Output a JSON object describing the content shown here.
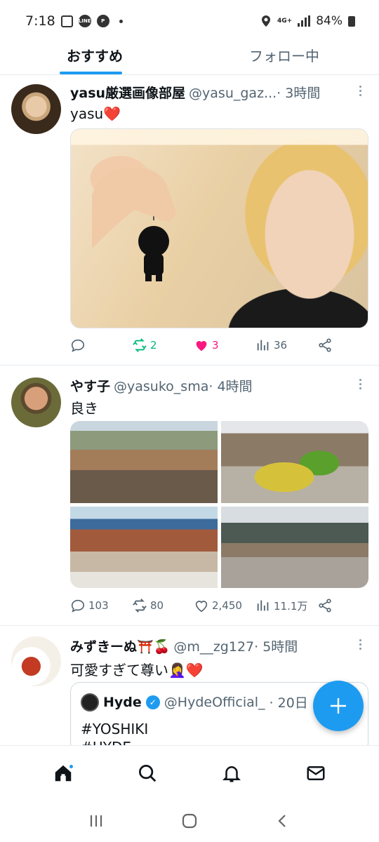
{
  "status_bar": {
    "time": "7:18",
    "line_label": "LINE",
    "network": "4G+",
    "battery": "84%"
  },
  "tabs": [
    {
      "label": "おすすめ",
      "active": true
    },
    {
      "label": "フォロー中",
      "active": false
    }
  ],
  "tweets": [
    {
      "name": "yasu厳選画像部屋",
      "handle": "@yasu_gaz...",
      "time": " · 3時間",
      "text": "yasu",
      "text_emoji": "❤️",
      "actions": {
        "reply": "",
        "retweet": "2",
        "like": "3",
        "views": "36"
      },
      "liked": true
    },
    {
      "name": "やす子",
      "handle": "@yasuko_sma",
      "time": " · 4時間",
      "text": "良き",
      "actions": {
        "reply": "103",
        "retweet": "80",
        "like": "2,450",
        "views": "11.1万"
      },
      "liked": false
    },
    {
      "name": "みずきーぬ⛩️🍒",
      "handle": "@m__zg127",
      "time": " · 5時間",
      "text": "可愛すぎて尊い🤦‍♀️",
      "text_emoji": "❤️"
    }
  ],
  "quote": {
    "name": "Hyde",
    "handle": "@HydeOfficial_",
    "time": " · 20日",
    "line1": "#YOSHIKI",
    "line2": "#HYDE"
  },
  "colors": {
    "accent": "#1d9bf0",
    "retweet": "#00ba7c",
    "like": "#f91880",
    "secondary_text": "#536471"
  },
  "icons": {
    "nav": [
      "home-icon",
      "search-icon",
      "bell-icon",
      "mail-icon"
    ],
    "system": [
      "recents-icon",
      "home-circle-icon",
      "back-icon"
    ],
    "fab": "plus-icon"
  }
}
